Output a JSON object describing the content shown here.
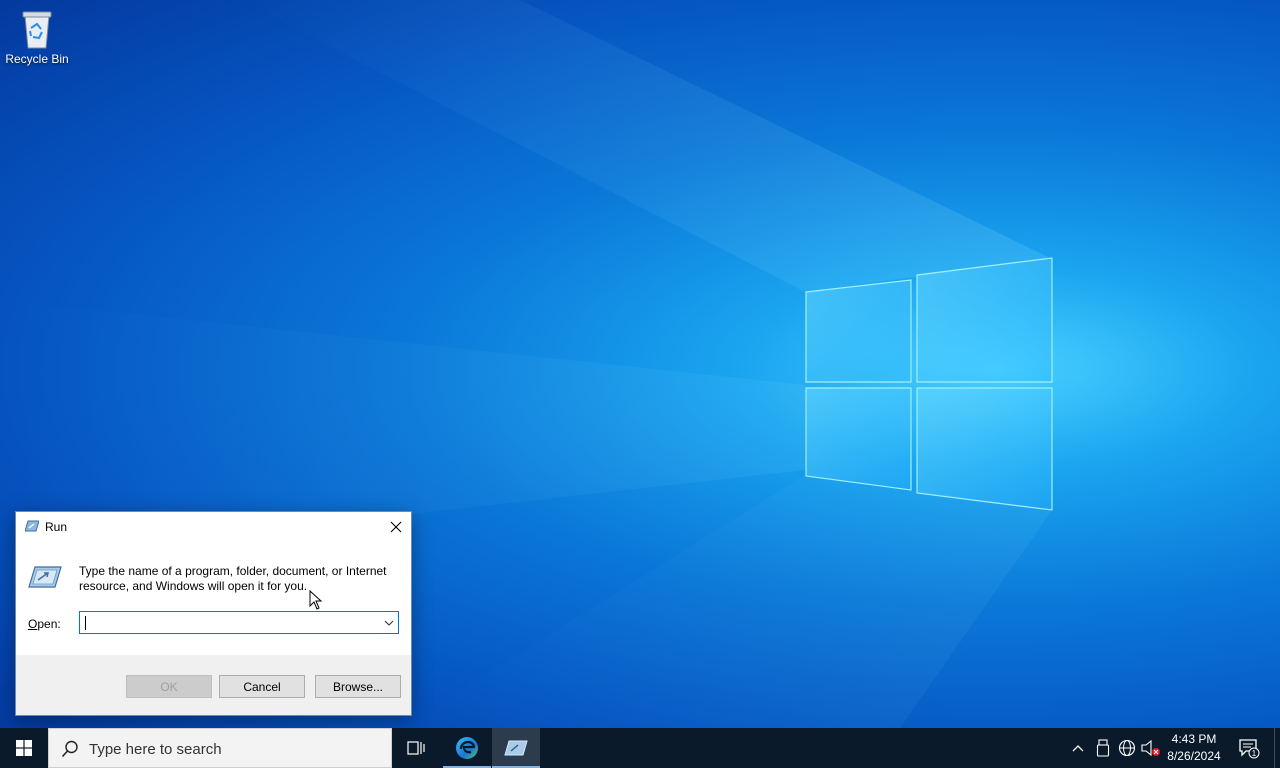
{
  "desktop": {
    "icons": [
      {
        "label": "Recycle Bin",
        "icon": "recycle-bin-icon"
      }
    ],
    "wallpaper": "windows-logo-light"
  },
  "run_dialog": {
    "title": "Run",
    "description": "Type the name of a program, folder, document, or Internet resource, and Windows will open it for you.",
    "open_label_underline": "O",
    "open_label_rest": "pen:",
    "open_value": "",
    "buttons": {
      "ok": "OK",
      "cancel": "Cancel",
      "browse": "Browse..."
    },
    "ok_enabled": false
  },
  "taskbar": {
    "search_placeholder": "Type here to search",
    "pinned": [
      "task-view-icon",
      "edge-icon",
      "run-app-icon"
    ],
    "clock": {
      "time": "4:43 PM",
      "date": "8/26/2024"
    },
    "notification_count": "1",
    "tray_icons": [
      "chevron-up-icon",
      "usb-icon",
      "network-globe-icon",
      "volume-muted-icon"
    ]
  },
  "colors": {
    "taskbar_bg": "#0a1a2b",
    "accent": "#0078d7",
    "dialog_bg": "#f0f0f0"
  }
}
